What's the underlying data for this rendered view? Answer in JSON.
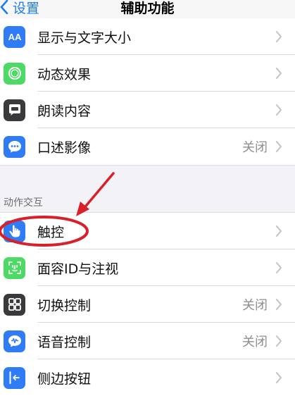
{
  "nav": {
    "back_label": "设置",
    "title": "辅助功能"
  },
  "group1": [
    {
      "label": "显示与文字大小",
      "icon": "text-size-icon",
      "color": "#2f7cf6",
      "value": ""
    },
    {
      "label": "动态效果",
      "icon": "motion-icon",
      "color": "#4cd964",
      "value": ""
    },
    {
      "label": "朗读内容",
      "icon": "speech-bubble-icon",
      "color": "#3a3a3c",
      "value": ""
    },
    {
      "label": "口述影像",
      "icon": "audio-description-icon",
      "color": "#2f7cf6",
      "value": "关闭"
    }
  ],
  "section2_header": "动作交互",
  "group2": [
    {
      "label": "触控",
      "icon": "touch-hand-icon",
      "color": "#2f7cf6",
      "value": ""
    },
    {
      "label": "面容ID与注视",
      "icon": "face-id-icon",
      "color": "#4cd964",
      "value": ""
    },
    {
      "label": "切换控制",
      "icon": "switch-control-icon",
      "color": "#3a3a3c",
      "value": "关闭"
    },
    {
      "label": "语音控制",
      "icon": "voice-control-icon",
      "color": "#2f7cf6",
      "value": "关闭"
    },
    {
      "label": "侧边按钮",
      "icon": "side-button-icon",
      "color": "#2f7cf6",
      "value": ""
    }
  ],
  "annotation": {
    "color": "#d9202a"
  }
}
